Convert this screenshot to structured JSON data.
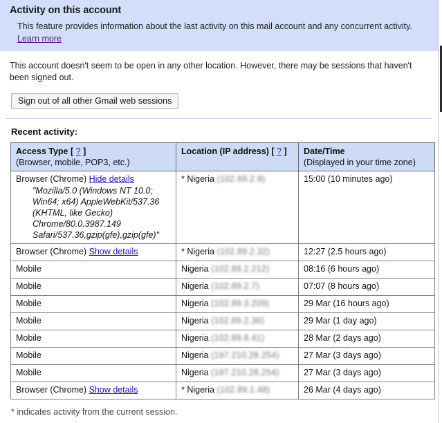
{
  "banner": {
    "title": "Activity on this account",
    "description": "This feature provides information about the last activity on this mail account and any concurrent activity.",
    "learn_more_label": "Learn more",
    "background_color": "#d2defa",
    "link_color": "#551a8b"
  },
  "intro": {
    "text": "This account doesn't seem to be open in any other location. However, there may be sessions that haven't been signed out."
  },
  "actions": {
    "sign_out_label": "Sign out of all other Gmail web sessions"
  },
  "recent": {
    "heading": "Recent activity:"
  },
  "table": {
    "columns": [
      {
        "main": "Access Type",
        "help": "?",
        "sub": "(Browser, mobile, POP3, etc.)"
      },
      {
        "main": "Location (IP address)",
        "help": "?",
        "sub": ""
      },
      {
        "main": "Date/Time",
        "help": "",
        "sub": "(Displayed in your time zone)"
      }
    ],
    "rows": [
      {
        "access": "Browser (Chrome)",
        "details_link": "Hide details",
        "user_agent": "\"Mozilla/5.0 (Windows NT 10.0; Win64; x64) AppleWebKit/537.36 (KHTML, like Gecko) Chrome/80.0.3987.149 Safari/537.36,gzip(gfe),gzip(gfe)\"",
        "current": "*",
        "location": "Nigeria",
        "ip": "(102.89.2.9)",
        "datetime": "15:00 (10 minutes ago)"
      },
      {
        "access": "Browser (Chrome)",
        "details_link": "Show details",
        "user_agent": "",
        "current": "*",
        "location": "Nigeria",
        "ip": "(102.89.2.32)",
        "datetime": "12:27 (2.5 hours ago)"
      },
      {
        "access": "Mobile",
        "details_link": "",
        "user_agent": "",
        "current": "",
        "location": "Nigeria",
        "ip": "(102.89.2.212)",
        "datetime": "08:16 (6 hours ago)"
      },
      {
        "access": "Mobile",
        "details_link": "",
        "user_agent": "",
        "current": "",
        "location": "Nigeria",
        "ip": "(102.89.2.7)",
        "datetime": "07:07 (8 hours ago)"
      },
      {
        "access": "Mobile",
        "details_link": "",
        "user_agent": "",
        "current": "",
        "location": "Nigeria",
        "ip": "(102.89.3.209)",
        "datetime": "29 Mar (16 hours ago)"
      },
      {
        "access": "Mobile",
        "details_link": "",
        "user_agent": "",
        "current": "",
        "location": "Nigeria",
        "ip": "(102.89.2.36)",
        "datetime": "29 Mar (1 day ago)"
      },
      {
        "access": "Mobile",
        "details_link": "",
        "user_agent": "",
        "current": "",
        "location": "Nigeria",
        "ip": "(102.89.8.41)",
        "datetime": "28 Mar (2 days ago)"
      },
      {
        "access": "Mobile",
        "details_link": "",
        "user_agent": "",
        "current": "",
        "location": "Nigeria",
        "ip": "(197.210.28.254)",
        "datetime": "27 Mar (3 days ago)"
      },
      {
        "access": "Mobile",
        "details_link": "",
        "user_agent": "",
        "current": "",
        "location": "Nigeria",
        "ip": "(197.210.28.254)",
        "datetime": "27 Mar (3 days ago)"
      },
      {
        "access": "Browser (Chrome)",
        "details_link": "Show details",
        "user_agent": "",
        "current": "*",
        "location": "Nigeria",
        "ip": "(102.89.1.48)",
        "datetime": "26 Mar (4 days ago)"
      }
    ]
  },
  "footnote": {
    "text": "* indicates activity from the current session."
  }
}
